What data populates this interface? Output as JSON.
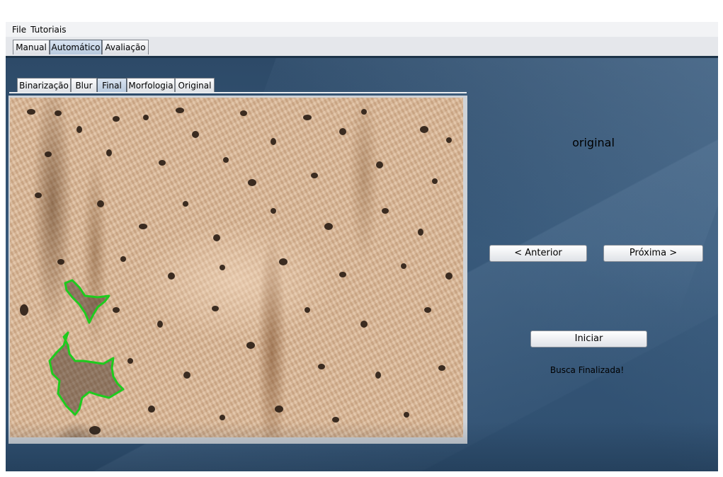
{
  "menubar": {
    "items": [
      "File",
      "Tutoriais"
    ]
  },
  "main_tabs": {
    "items": [
      "Manual",
      "Automático",
      "Avaliação"
    ],
    "selected": "Automático"
  },
  "sub_tabs": {
    "items": [
      "Binarização",
      "Blur",
      "Final",
      "Morfologia",
      "Original"
    ],
    "selected": "Final"
  },
  "viewer": {
    "image_label": "original",
    "prev_label": "< Anterior",
    "next_label": "Próxima >",
    "start_label": "Iniciar",
    "status_text": "Busca Finalizada!"
  },
  "colors": {
    "contour": "#1ecb1e",
    "workspace": "#35557a",
    "selected_tab": "#c4d3e5"
  }
}
